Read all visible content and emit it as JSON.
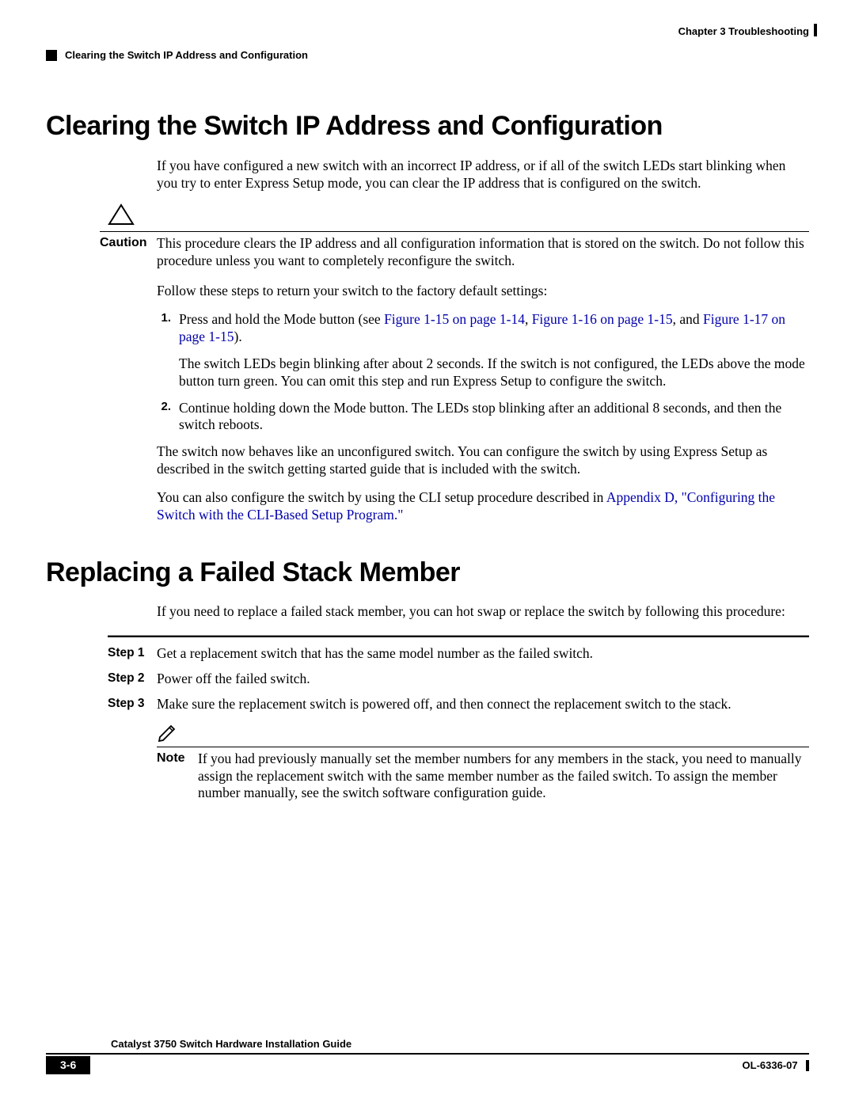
{
  "header": {
    "chapter_label": "Chapter 3      Troubleshooting",
    "section_header": "Clearing the Switch IP Address and Configuration"
  },
  "section1": {
    "title": "Clearing the Switch IP Address and Configuration",
    "intro": "If you have configured a new switch with an incorrect IP address, or if all of the switch LEDs start blinking when you try to enter Express Setup mode, you can clear the IP address that is configured on the switch.",
    "caution_label": "Caution",
    "caution_text": "This procedure clears the IP address and all configuration information that is stored on the switch. Do not follow this procedure unless you want to completely reconfigure the switch.",
    "follow": "Follow these steps to return your switch to the factory default settings:",
    "step1_num": "1.",
    "step1_a": "Press and hold the Mode button (see ",
    "step1_link1": "Figure 1-15 on page 1-14",
    "step1_sep1": ", ",
    "step1_link2": "Figure 1-16 on page 1-15",
    "step1_sep2": ", and ",
    "step1_link3": "Figure 1-17 on page 1-15",
    "step1_end": ").",
    "step1_b": "The switch LEDs begin blinking after about 2 seconds. If the switch is not configured, the LEDs above the mode button turn green. You can omit this step and run Express Setup to configure the switch.",
    "step2_num": "2.",
    "step2": "Continue holding down the Mode button. The LEDs stop blinking after an additional 8 seconds, and then the switch reboots.",
    "after1": "The switch now behaves like an unconfigured switch. You can configure the switch by using Express Setup as described in the switch getting started guide that is included with the switch.",
    "after2_a": "You can also configure the switch by using the CLI setup procedure described in ",
    "after2_link": "Appendix D, \"Configuring the Switch with the CLI-Based Setup Program.\""
  },
  "section2": {
    "title": "Replacing a Failed Stack Member",
    "intro": "If you need to replace a failed stack member, you can hot swap or replace the switch by following this procedure:",
    "step1_label": "Step 1",
    "step1": "Get a replacement switch that has the same model number as the failed switch.",
    "step2_label": "Step 2",
    "step2": "Power off the failed switch.",
    "step3_label": "Step 3",
    "step3": "Make sure the replacement switch is powered off, and then connect the replacement switch to the stack.",
    "note_label": "Note",
    "note_text": "If you had previously manually set the member numbers for any members in the stack, you need to manually assign the replacement switch with the same member number as the failed switch. To assign the member number manually, see the switch software configuration guide."
  },
  "footer": {
    "guide_title": "Catalyst 3750 Switch Hardware Installation Guide",
    "page_num": "3-6",
    "doc_id": "OL-6336-07"
  }
}
